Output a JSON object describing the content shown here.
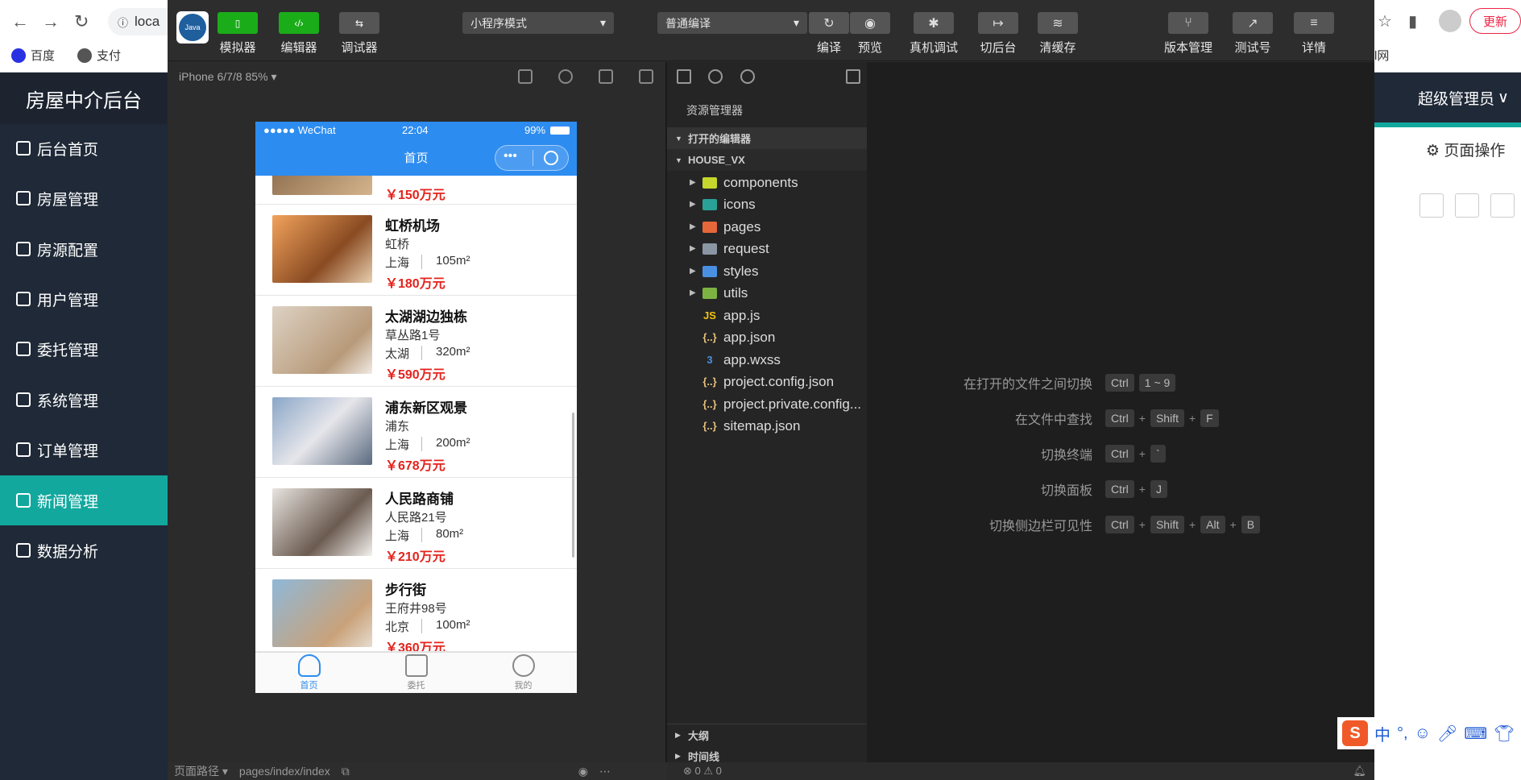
{
  "browser": {
    "url_fragment": "loca",
    "bookmarks": [
      "百度",
      "支付"
    ],
    "update_button": "更新",
    "partial_bookmark": "l网"
  },
  "admin": {
    "brand": "房屋中介后台",
    "menu": [
      {
        "label": "后台首页",
        "icon": "home-icon"
      },
      {
        "label": "房屋管理",
        "icon": "house-icon"
      },
      {
        "label": "房源配置",
        "icon": "config-icon"
      },
      {
        "label": "用户管理",
        "icon": "user-icon"
      },
      {
        "label": "委托管理",
        "icon": "delegate-icon"
      },
      {
        "label": "系统管理",
        "icon": "system-icon"
      },
      {
        "label": "订单管理",
        "icon": "order-icon"
      },
      {
        "label": "新闻管理",
        "icon": "news-icon"
      },
      {
        "label": "数据分析",
        "icon": "chart-icon"
      }
    ],
    "active_menu": "新闻管理",
    "user": "超级管理员",
    "page_ops": "页面操作",
    "accent_color": "#13a89e"
  },
  "toolbar": {
    "simulator": "模拟器",
    "editor": "编辑器",
    "debugger": "调试器",
    "mode": "小程序模式",
    "compile_mode": "普通编译",
    "compile": "编译",
    "preview": "预览",
    "device_debug": "真机调试",
    "background": "切后台",
    "clear_cache": "清缓存",
    "version": "版本管理",
    "test_account": "测试号",
    "details": "详情",
    "avatar_text": "Java"
  },
  "simulator": {
    "device": "iPhone 6/7/8 85%",
    "status_left": "●●●●● WeChat",
    "status_time": "22:04",
    "status_battery": "99%",
    "nav_title": "首页",
    "first_price": "￥150万元",
    "houses": [
      {
        "title": "虹桥机场",
        "addr": "虹桥",
        "city": "上海",
        "area": "105m²",
        "price": "￥180万元"
      },
      {
        "title": "太湖湖边独栋",
        "addr": "草丛路1号",
        "city": "太湖",
        "area": "320m²",
        "price": "￥590万元"
      },
      {
        "title": "浦东新区观景",
        "addr": "浦东",
        "city": "上海",
        "area": "200m²",
        "price": "￥678万元"
      },
      {
        "title": "人民路商铺",
        "addr": "人民路21号",
        "city": "上海",
        "area": "80m²",
        "price": "￥210万元"
      },
      {
        "title": "步行街",
        "addr": "王府井98号",
        "city": "北京",
        "area": "100m²",
        "price": "￥360万元"
      }
    ],
    "tabs": [
      "首页",
      "委托",
      "我的"
    ],
    "footer_path_label": "页面路径",
    "footer_path": "pages/index/index"
  },
  "explorer": {
    "title": "资源管理器",
    "open_editors": "打开的编辑器",
    "project": "HOUSE_VX",
    "folders": [
      {
        "name": "components",
        "color": "#c5d62d"
      },
      {
        "name": "icons",
        "color": "#2aa198"
      },
      {
        "name": "pages",
        "color": "#e5673a"
      },
      {
        "name": "request",
        "color": "#8a96a3"
      },
      {
        "name": "styles",
        "color": "#4a90e2"
      },
      {
        "name": "utils",
        "color": "#7cb342"
      }
    ],
    "files": [
      {
        "name": "app.js",
        "icon": "JS",
        "color": "#f1c40f"
      },
      {
        "name": "app.json",
        "icon": "{..}",
        "color": "#e5c07b"
      },
      {
        "name": "app.wxss",
        "icon": "3",
        "color": "#4a90e2"
      },
      {
        "name": "project.config.json",
        "icon": "{..}",
        "color": "#e5c07b"
      },
      {
        "name": "project.private.config...",
        "icon": "{..}",
        "color": "#e5c07b"
      },
      {
        "name": "sitemap.json",
        "icon": "{..}",
        "color": "#e5c07b"
      }
    ],
    "outline": "大纲",
    "timeline": "时间线"
  },
  "shortcuts": [
    {
      "label": "在打开的文件之间切换",
      "keys": [
        "Ctrl",
        "1 ~ 9"
      ],
      "joined": false
    },
    {
      "label": "在文件中查找",
      "keys": [
        "Ctrl",
        "Shift",
        "F"
      ],
      "joined": true
    },
    {
      "label": "切换终端",
      "keys": [
        "Ctrl",
        "`"
      ],
      "joined": true
    },
    {
      "label": "切换面板",
      "keys": [
        "Ctrl",
        "J"
      ],
      "joined": true
    },
    {
      "label": "切换侧边栏可见性",
      "keys": [
        "Ctrl",
        "Shift",
        "Alt",
        "B"
      ],
      "joined": true
    }
  ],
  "status": {
    "problems": "⊗ 0 ⚠ 0"
  },
  "ime": {
    "logo": "S",
    "lang": "中"
  }
}
